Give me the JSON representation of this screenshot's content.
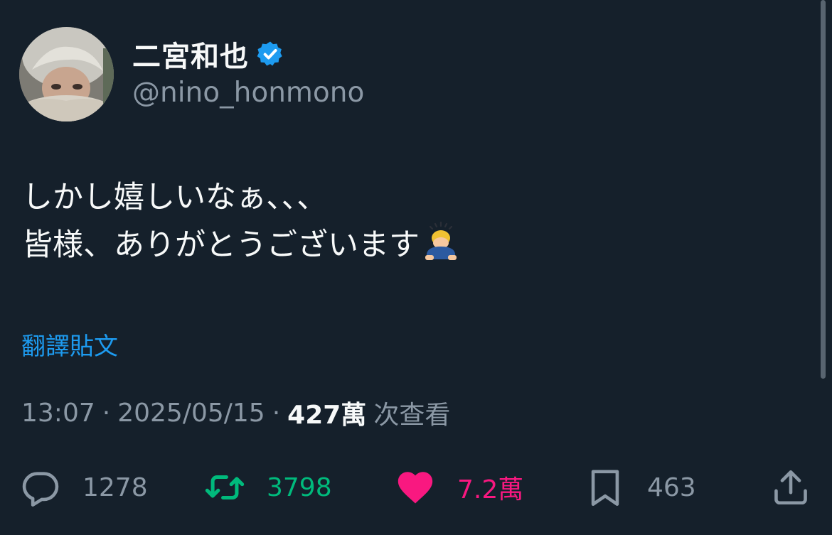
{
  "user": {
    "display_name": "二宮和也",
    "handle": "@nino_honmono",
    "verified": true,
    "verified_color": "#1d9bf0",
    "avatar_icon": "user-avatar"
  },
  "tweet": {
    "lines": [
      "しかし嬉しいなぁ、、、",
      "皆様、ありがとうございます"
    ],
    "trailing_emoji": "bowing-man-emoji",
    "translate_label": "翻譯貼文"
  },
  "meta": {
    "time": "13:07",
    "separator": "·",
    "date": "2025/05/15",
    "views_count": "427萬",
    "views_label": "次查看"
  },
  "actions": {
    "reply": {
      "icon": "reply-icon",
      "count": "1278"
    },
    "retweet": {
      "icon": "retweet-icon",
      "count": "3798",
      "color": "#00ba7c"
    },
    "like": {
      "icon": "heart-icon",
      "count": "7.2萬",
      "color": "#f91880"
    },
    "bookmark": {
      "icon": "bookmark-icon",
      "count": "463"
    },
    "share": {
      "icon": "share-icon"
    }
  },
  "colors": {
    "background": "#15202b",
    "text_primary": "#f7f9f9",
    "text_secondary": "#8b98a5",
    "link": "#1d9bf0"
  }
}
